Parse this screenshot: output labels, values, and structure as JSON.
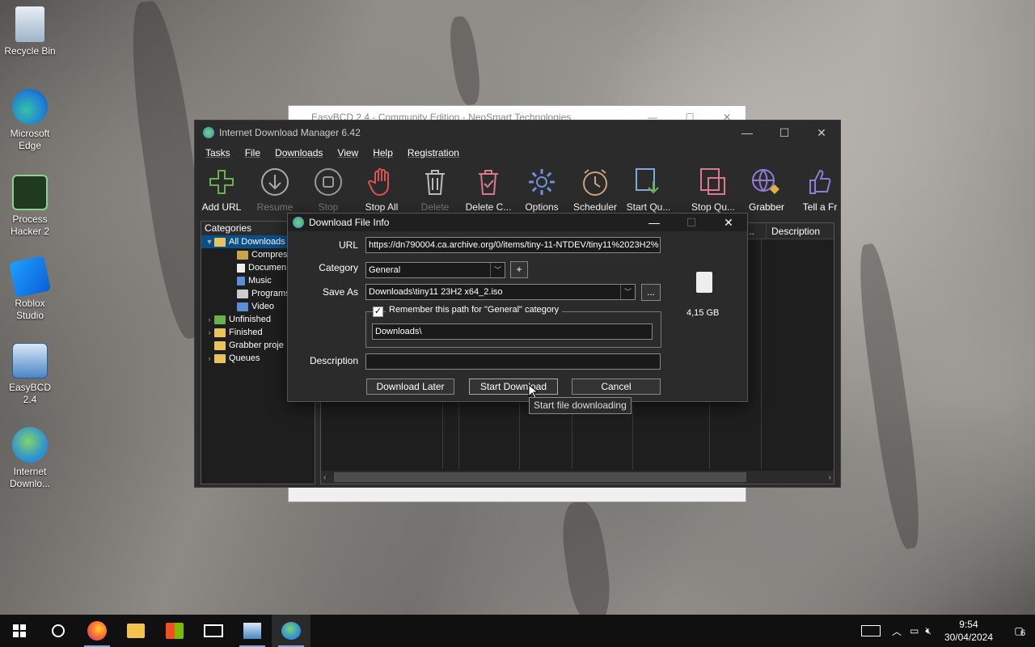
{
  "desktop": {
    "icons": [
      {
        "label": "Recycle Bin"
      },
      {
        "label": "Microsoft Edge"
      },
      {
        "label": "Process Hacker 2"
      },
      {
        "label": "Roblox Studio"
      },
      {
        "label": "EasyBCD 2.4"
      },
      {
        "label": "Internet Downlo..."
      }
    ]
  },
  "easybcd": {
    "title": "EasyBCD 2.4 - Community Edition - NeoSmart Technologies"
  },
  "idm": {
    "title": "Internet Download Manager 6.42",
    "menu": [
      "Tasks",
      "File",
      "Downloads",
      "View",
      "Help",
      "Registration"
    ],
    "toolbar": [
      {
        "label": "Add URL",
        "icon": "plus-icon"
      },
      {
        "label": "Resume",
        "icon": "resume-icon"
      },
      {
        "label": "Stop",
        "icon": "stop-icon"
      },
      {
        "label": "Stop All",
        "icon": "hand-icon"
      },
      {
        "label": "Delete",
        "icon": "trash-icon"
      },
      {
        "label": "Delete C...",
        "icon": "delete-completed-icon"
      },
      {
        "label": "Options",
        "icon": "gear-icon"
      },
      {
        "label": "Scheduler",
        "icon": "clock-icon"
      },
      {
        "label": "Start Qu...",
        "icon": "start-queue-icon"
      },
      {
        "label": "Stop Qu...",
        "icon": "stop-queue-icon"
      },
      {
        "label": "Grabber",
        "icon": "globe-icon"
      },
      {
        "label": "Tell a Fr",
        "icon": "thumbs-up-icon"
      }
    ],
    "categories": {
      "header": "Categories",
      "items": [
        {
          "label": "All Downloads",
          "level": 0,
          "arrow": "▼"
        },
        {
          "label": "Compress",
          "level": 1
        },
        {
          "label": "Documen",
          "level": 1
        },
        {
          "label": "Music",
          "level": 1
        },
        {
          "label": "Programs",
          "level": 1
        },
        {
          "label": "Video",
          "level": 1
        },
        {
          "label": "Unfinished",
          "level": 0,
          "arrow": "›"
        },
        {
          "label": "Finished",
          "level": 0,
          "arrow": "›"
        },
        {
          "label": "Grabber proje",
          "level": 0,
          "arrow": ""
        },
        {
          "label": "Queues",
          "level": 0,
          "arrow": "›"
        }
      ]
    },
    "list": {
      "col_truncated": "...",
      "col_description": "Description"
    }
  },
  "dialog": {
    "title": "Download File Info",
    "url_label": "URL",
    "url_value": "https://dn790004.ca.archive.org/0/items/tiny-11-NTDEV/tiny11%2023H2%",
    "category_label": "Category",
    "category_value": "General",
    "add_category": "+",
    "saveas_label": "Save As",
    "saveas_value": "Downloads\\tiny11 23H2 x64_2.iso",
    "browse": "...",
    "remember_label": "Remember this path for \"General\" category",
    "remember_checked": true,
    "remember_path": "Downloads\\",
    "description_label": "Description",
    "description_value": "",
    "file_size": "4,15  GB",
    "btn_later": "Download Later",
    "btn_start": "Start Download",
    "btn_cancel": "Cancel",
    "tooltip": "Start file downloading"
  },
  "taskbar": {
    "time": "9:54",
    "date": "30/04/2024",
    "notifications": "6"
  }
}
